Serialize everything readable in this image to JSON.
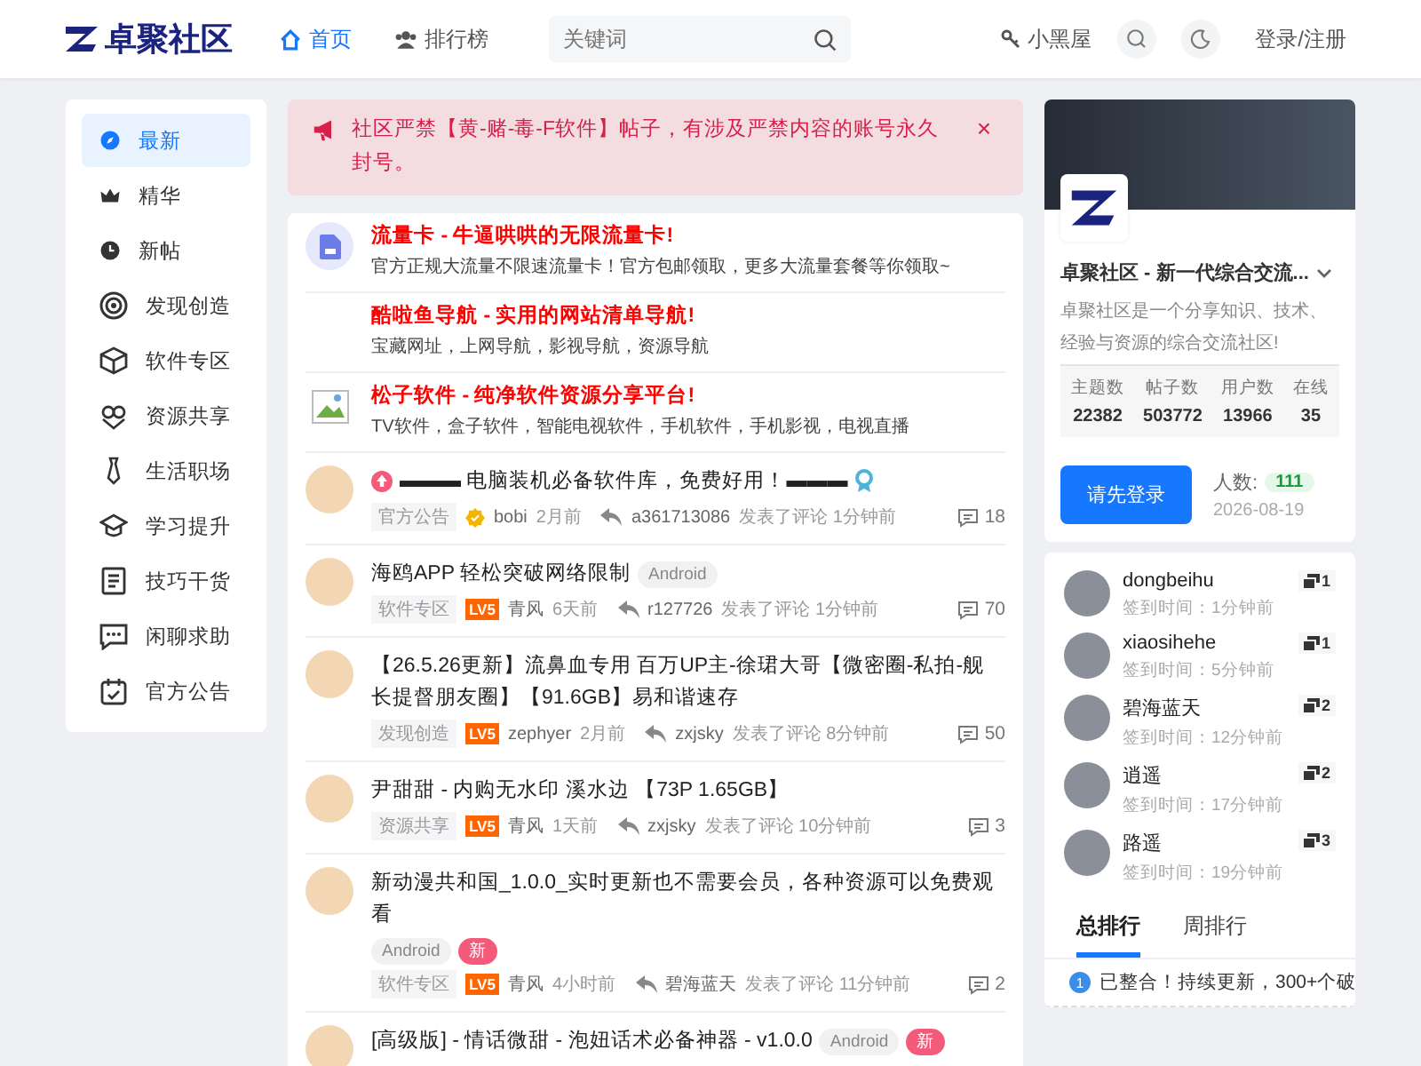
{
  "header": {
    "logo": "卓聚社区",
    "nav": [
      {
        "label": "首页",
        "selected": true
      },
      {
        "label": "排行榜",
        "selected": false
      }
    ],
    "search": {
      "placeholder": "关键词"
    },
    "links": [
      {
        "label": "小黑屋"
      }
    ],
    "login": "登录/注册"
  },
  "sidebar": {
    "items": [
      {
        "label": "最新",
        "selected": true
      },
      {
        "label": "精华",
        "selected": false
      },
      {
        "label": "新帖",
        "selected": false
      },
      {
        "label": "发现创造",
        "selected": false
      },
      {
        "label": "软件专区",
        "selected": false
      },
      {
        "label": "资源共享",
        "selected": false
      },
      {
        "label": "生活职场",
        "selected": false
      },
      {
        "label": "学习提升",
        "selected": false
      },
      {
        "label": "技巧干货",
        "selected": false
      },
      {
        "label": "闲聊求助",
        "selected": false
      },
      {
        "label": "官方公告",
        "selected": false
      }
    ]
  },
  "notice": {
    "text": "社区严禁【黄-赌-毒-F软件】帖子，有涉及严禁内容的账号永久封号。",
    "close": "×"
  },
  "ads": [
    {
      "title": "流量卡 - 牛逼哄哄的无限流量卡!",
      "desc": "官方正规大流量不限速流量卡！官方包邮领取，更多大流量套餐等你领取~"
    },
    {
      "title": "酷啦鱼导航 - 实用的网站清单导航!",
      "desc": "宝藏网址，上网导航，影视导航，资源导航"
    },
    {
      "title": "松子软件 - 纯净软件资源分享平台!",
      "desc": "TV软件，盒子软件，智能电视软件，手机软件，手机影视，电视直播"
    }
  ],
  "posts": [
    {
      "title": "▬▬▬ 电脑装机必备软件库，免费好用！▬▬▬",
      "pinned": true,
      "award": true,
      "category": "官方公告",
      "verified": true,
      "author": "bobi",
      "time": "2月前",
      "replier": "a361713086",
      "action": "发表了评论",
      "reply_time": "1分钟前",
      "comments": "18"
    },
    {
      "title": "海鸥APP 轻松突破网络限制",
      "pinned": false,
      "award": false,
      "tags": [
        {
          "label": "Android",
          "kind": "platform"
        }
      ],
      "category": "软件专区",
      "verified": false,
      "level_badge": "LV5",
      "author": "青风",
      "time": "6天前",
      "replier": "r127726",
      "action": "发表了评论",
      "reply_time": "1分钟前",
      "comments": "70"
    },
    {
      "title": "【26.5.26更新】流鼻血专用 百万UP主-徐珺大哥【微密圈-私拍-舰长提督朋友圈】【91.6GB】易和谐速存",
      "pinned": false,
      "award": false,
      "category": "发现创造",
      "verified": false,
      "level_badge": "LV5",
      "author": "zephyer",
      "time": "2月前",
      "replier": "zxjsky",
      "action": "发表了评论",
      "reply_time": "8分钟前",
      "comments": "50"
    },
    {
      "title": "尹甜甜 - 内购无水印 溪水边 【73P 1.65GB】",
      "pinned": false,
      "award": false,
      "category": "资源共享",
      "verified": false,
      "level_badge": "LV5",
      "author": "青风",
      "time": "1天前",
      "replier": "zxjsky",
      "action": "发表了评论",
      "reply_time": "10分钟前",
      "comments": "3"
    },
    {
      "title": "新动漫共和国_1.0.0_实时更新也不需要会员，各种资源可以免费观看",
      "pinned": false,
      "award": false,
      "tags": [
        {
          "label": "Android",
          "kind": "platform"
        },
        {
          "label": "新",
          "kind": "new"
        }
      ],
      "category": "软件专区",
      "verified": false,
      "level_badge": "LV5",
      "author": "青风",
      "time": "4小时前",
      "replier": "碧海蓝天",
      "action": "发表了评论",
      "reply_time": "11分钟前",
      "comments": "2"
    },
    {
      "title": "[高级版] - 情话微甜 - 泡妞话术必备神器 - v1.0.0",
      "pinned": false,
      "award": false,
      "tags": [
        {
          "label": "Android",
          "kind": "platform"
        },
        {
          "label": "新",
          "kind": "new"
        }
      ]
    }
  ],
  "community": {
    "title": "卓聚社区 - 新一代综合交流...",
    "desc": "卓聚社区是一个分享知识、技术、经验与资源的综合交流社区!",
    "stats": [
      {
        "label": "主题数",
        "value": "22382"
      },
      {
        "label": "帖子数",
        "value": "503772"
      },
      {
        "label": "用户数",
        "value": "13966"
      },
      {
        "label": "在线",
        "value": "35"
      }
    ],
    "login_button": "请先登录",
    "count_label": "人数:",
    "count": "111",
    "date": "2026-08-19"
  },
  "checkins": [
    {
      "name": "dongbeihu",
      "time": "签到时间：1分钟前",
      "days": "1"
    },
    {
      "name": "xiaosihehe",
      "time": "签到时间：5分钟前",
      "days": "1"
    },
    {
      "name": "碧海蓝天",
      "time": "签到时间：12分钟前",
      "days": "2"
    },
    {
      "name": "逍遥",
      "time": "签到时间：17分钟前",
      "days": "2"
    },
    {
      "name": "路遥",
      "time": "签到时间：19分钟前",
      "days": "3"
    }
  ],
  "rank_tabs": [
    {
      "label": "总排行",
      "selected": true
    },
    {
      "label": "周排行",
      "selected": false
    }
  ],
  "ranking": [
    {
      "rank": "1",
      "title": "已整合！持续更新，300+个破"
    }
  ]
}
